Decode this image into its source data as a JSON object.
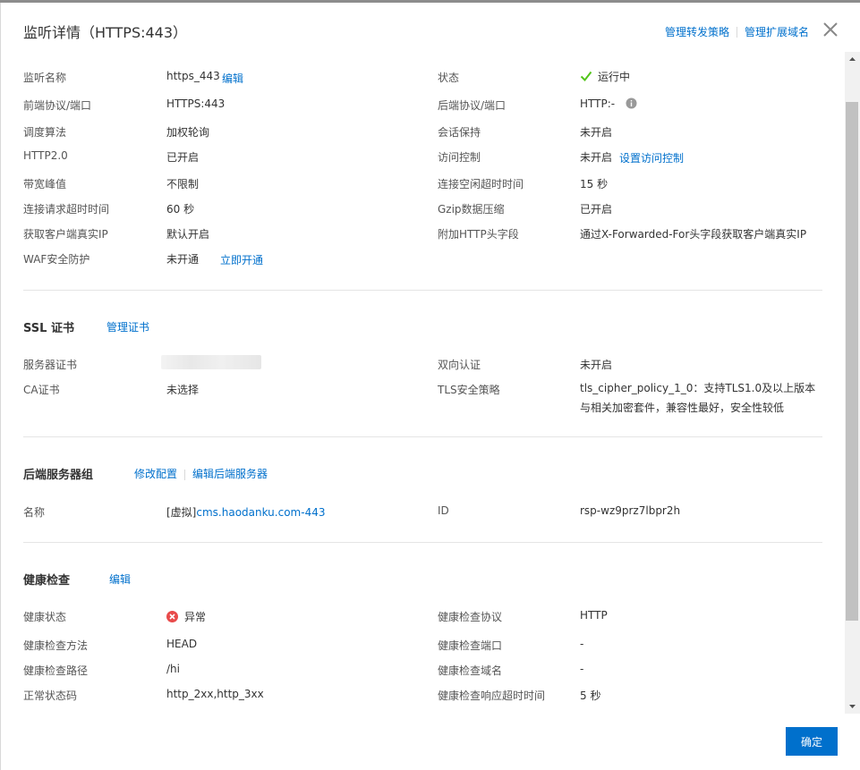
{
  "header": {
    "title": "监听详情（HTTPS:443）",
    "link_forward": "管理转发策略",
    "link_domain": "管理扩展域名"
  },
  "listener": {
    "name_label": "监听名称",
    "name_value": "https_443",
    "name_edit": "编辑",
    "status_label": "状态",
    "status_value": "运行中",
    "frontend_label": "前端协议/端口",
    "frontend_value": "HTTPS:443",
    "backend_label": "后端协议/端口",
    "backend_value": "HTTP:-",
    "sched_label": "调度算法",
    "sched_value": "加权轮询",
    "session_label": "会话保持",
    "session_value": "未开启",
    "http2_label": "HTTP2.0",
    "http2_value": "已开启",
    "acl_label": "访问控制",
    "acl_value": "未开启",
    "acl_link": "设置访问控制",
    "bw_label": "带宽峰值",
    "bw_value": "不限制",
    "idle_label": "连接空闲超时时间",
    "idle_value": "15 秒",
    "req_label": "连接请求超时时间",
    "req_value": "60 秒",
    "gzip_label": "Gzip数据压缩",
    "gzip_value": "已开启",
    "realip_label": "获取客户端真实IP",
    "realip_value": "默认开启",
    "header_label": "附加HTTP头字段",
    "header_value": "通过X-Forwarded-For头字段获取客户端真实IP",
    "waf_label": "WAF安全防护",
    "waf_value": "未开通",
    "waf_link": "立即开通"
  },
  "ssl": {
    "title": "SSL 证书",
    "manage_link": "管理证书",
    "server_cert_label": "服务器证书",
    "mutual_label": "双向认证",
    "mutual_value": "未开启",
    "ca_label": "CA证书",
    "ca_value": "未选择",
    "tls_label": "TLS安全策略",
    "tls_value": "tls_cipher_policy_1_0：支持TLS1.0及以上版本与相关加密套件，兼容性最好，安全性较低"
  },
  "backend_group": {
    "title": "后端服务器组",
    "modify_link": "修改配置",
    "edit_link": "编辑后端服务器",
    "name_label": "名称",
    "name_prefix": "[虚拟]",
    "name_link": "cms.haodanku.com-443",
    "id_label": "ID",
    "id_value": "rsp-wz9prz7lbpr2h"
  },
  "health": {
    "title": "健康检查",
    "edit_link": "编辑",
    "status_label": "健康状态",
    "status_value": "异常",
    "protocol_label": "健康检查协议",
    "protocol_value": "HTTP",
    "method_label": "健康检查方法",
    "method_value": "HEAD",
    "port_label": "健康检查端口",
    "port_value": "-",
    "path_label": "健康检查路径",
    "path_value": "/hi",
    "domain_label": "健康检查域名",
    "domain_value": "-",
    "code_label": "正常状态码",
    "code_value": "http_2xx,http_3xx",
    "timeout_label": "健康检查响应超时时间",
    "timeout_value": "5 秒"
  },
  "footer": {
    "ok_label": "确定"
  },
  "colors": {
    "link": "#0070cc",
    "success": "#52c41a",
    "error": "#e84a4a",
    "primary": "#0070cc"
  },
  "icons": [
    "close-icon",
    "check-icon",
    "info-icon",
    "error-icon",
    "scroll-up-icon",
    "scroll-down-icon"
  ]
}
